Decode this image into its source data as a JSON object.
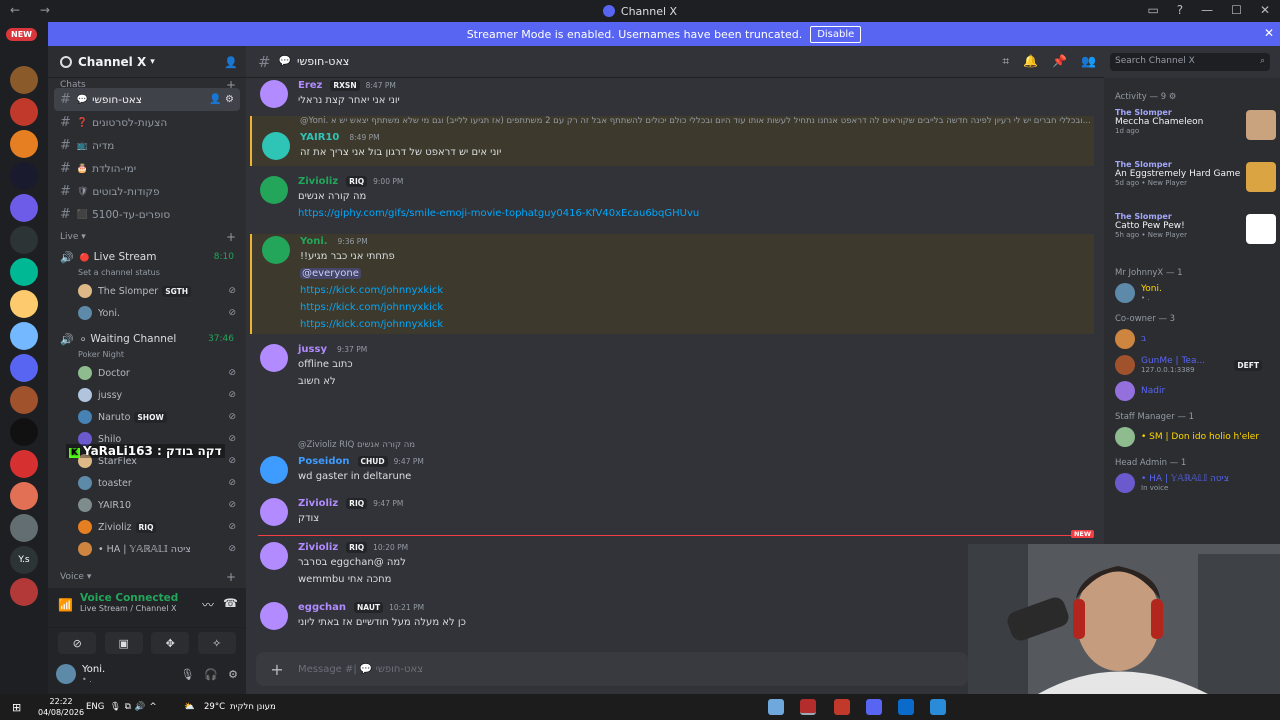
{
  "window": {
    "title": "Channel X"
  },
  "banner": {
    "text": "Streamer Mode is enabled. Usernames have been truncated.",
    "button": "Disable"
  },
  "server_rail": {
    "new_badge": "NEW"
  },
  "guild": {
    "name": "Channel X"
  },
  "channels": {
    "category_top": "Chats",
    "items": [
      {
        "emoji": "💬",
        "name": "צאט-חופשי"
      },
      {
        "emoji": "❓",
        "name": "הצעות-לסרטונים"
      },
      {
        "emoji": "📺",
        "name": "מדיה"
      },
      {
        "emoji": "🎂",
        "name": "ימי-הולדת"
      },
      {
        "emoji": "🛡",
        "name": "פקודות-לבוטים"
      },
      {
        "emoji": "⬛",
        "name": "סופרים-עד-5100"
      }
    ],
    "live_category": "Live",
    "voice_category": "Voice"
  },
  "voice_channels": {
    "live_stream": {
      "name": "Live Stream",
      "time": "8:10",
      "status": "Set a channel status",
      "users": [
        {
          "name": "The Slomper",
          "tag": "SGTH"
        },
        {
          "name": "Yoni."
        }
      ]
    },
    "waiting": {
      "name": "Waiting Channel",
      "time": "37:46",
      "status": "Poker Night",
      "users": [
        {
          "name": "Doctor"
        },
        {
          "name": "jussy"
        },
        {
          "name": "Naruto",
          "tag": "SHOW"
        },
        {
          "name": "Shilo"
        },
        {
          "name": "StarFlex"
        },
        {
          "name": "toaster"
        },
        {
          "name": "YAIR10"
        },
        {
          "name": "Zivioliz",
          "tag": "RIQ"
        },
        {
          "name": "• HA | 𝕐𝔸ℝ𝔸𝕃𝕀 ציטה"
        }
      ]
    }
  },
  "stream_overlay": {
    "text": "YaRaLi163 : דקה בודק"
  },
  "voice_connected": {
    "title": "Voice Connected",
    "sub": "Live Stream / Channel X"
  },
  "current_user": {
    "name": "Yoni.",
    "status": "• ."
  },
  "chat_header": {
    "channel": "צאט-חופשי",
    "search_placeholder": "Search Channel X"
  },
  "messages": [
    {
      "author": "Erez",
      "tag": "RXSN",
      "time": "8:47 PM",
      "lines": [
        "יוני אני יאחר קצת נראלי"
      ],
      "color": "#b18bff"
    },
    {
      "author": "YAIR10",
      "time": "8:49 PM",
      "reply": "@Yoni. ובכללי חברים יש לי רעיון לפינה חדשה בלייבים שקוראים לה דראפט אנחנו נתחיל לעשות אותו עוד היום ובכללי כולם יכולים להשתתף אבל זה רק עם 2 משתתפים (אז תגיעו ללייב) וגם מי שלא משתתף יצאש יש א...",
      "lines": [
        "יוני אים יש דראפט של דרגון בול אני צריך את זה"
      ],
      "color": "#2ec4b6",
      "highlight": true
    },
    {
      "author": "Zivioliz",
      "tag": "RIQ",
      "time": "9:00 PM",
      "lines": [
        "מה קורה אנשים"
      ],
      "link": "https://giphy.com/gifs/smile-emoji-movie-tophatguy0416-KfV40xEcau6bqGHUvu",
      "color": "#23a55a"
    },
    {
      "author": "Yoni.",
      "time": "9:36 PM",
      "lines": [
        "פתחתי אני כבר מגיע!!"
      ],
      "mention": "@everyone",
      "links": [
        "https://kick.com/johnnyxkick",
        "https://kick.com/johnnyxkick",
        "https://kick.com/johnnyxkick"
      ],
      "color": "#23a55a",
      "highlight": true
    },
    {
      "author": "jussy",
      "time": "9:37 PM",
      "lines": [
        "כתוב offline",
        "לא חשוב"
      ],
      "color": "#b18bff"
    },
    {
      "author": "Poseidon",
      "tag": "CHUD",
      "time": "9:47 PM",
      "reply": "@Zivioliz RIQ מה קורה אנשים",
      "lines": [
        "wd gaster in deltarune"
      ],
      "color": "#3e9bff"
    },
    {
      "author": "Zivioliz",
      "tag": "RIQ",
      "time": "9:47 PM",
      "lines": [
        "צודק"
      ],
      "color": "#b18bff"
    },
    {
      "author": "Zivioliz",
      "tag": "RIQ",
      "time": "10:20 PM",
      "lines": [
        "למה @eggchan בסרבר",
        "wemmbu מחכה אחי"
      ],
      "color": "#b18bff"
    },
    {
      "author": "eggchan",
      "tag": "NAUT",
      "time": "10:21 PM",
      "lines": [
        "כן לא מעלה מעל חודשיים אז באתי ליוני"
      ],
      "color": "#b18bff"
    }
  ],
  "new_divider": "NEW",
  "input": {
    "placeholder": "Message #| 💬 צאט-חופשי"
  },
  "members": {
    "activity_header": "Activity — 9",
    "activities": [
      {
        "game": "The Slomper",
        "title": "Meccha Chameleon",
        "meta": "1d ago"
      },
      {
        "game": "The Slomper",
        "title": "An Eggstremely Hard Game",
        "meta": "5d ago  •  New Player"
      },
      {
        "game": "The Slomper",
        "title": "Catto Pew Pew!",
        "meta": "5h ago  •  New Player"
      }
    ],
    "groups": [
      {
        "header": "Mr JohnnyX — 1",
        "members": [
          {
            "name": "Yoni.",
            "sub": "• ."
          }
        ]
      },
      {
        "header": "Co-owner — 3",
        "members": [
          {
            "name": "ב",
            "sub": ""
          },
          {
            "name": "GunMe | Tea...",
            "sub": "127.0.0.1:3389",
            "tag": "DEFT"
          },
          {
            "name": "Nadir",
            "sub": ""
          }
        ]
      },
      {
        "header": "Staff Manager — 1",
        "members": [
          {
            "name": "• SM | Don ido holio h'eler",
            "sub": ""
          }
        ]
      },
      {
        "header": "Head Admin — 1",
        "members": [
          {
            "name": "• HA | 𝕐𝔸ℝ𝔸𝕃𝕀 ציטה",
            "sub": "In voice"
          }
        ]
      }
    ]
  },
  "taskbar": {
    "time": "22:22",
    "date": "04/08/2026",
    "lang": "ENG",
    "weather": "29°C",
    "weather_text": "מעונן חלקית"
  }
}
